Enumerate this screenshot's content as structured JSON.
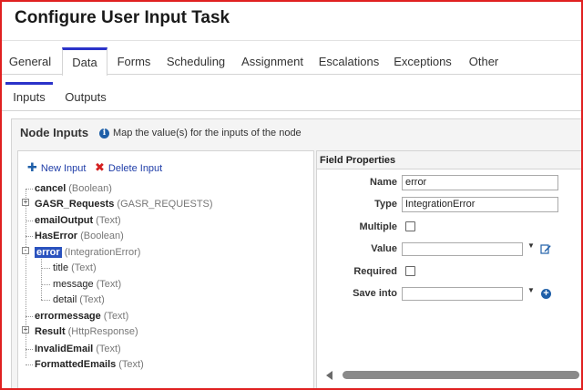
{
  "title": "Configure User Input Task",
  "tabs": [
    {
      "label": "General"
    },
    {
      "label": "Data"
    },
    {
      "label": "Forms"
    },
    {
      "label": "Scheduling"
    },
    {
      "label": "Assignment"
    },
    {
      "label": "Escalations"
    },
    {
      "label": "Exceptions"
    },
    {
      "label": "Other"
    }
  ],
  "active_tab": "Data",
  "subtabs": [
    {
      "label": "Inputs"
    },
    {
      "label": "Outputs"
    }
  ],
  "active_subtab": "Inputs",
  "panel": {
    "title": "Node Inputs",
    "info": "Map the value(s) for the inputs of the node"
  },
  "toolbar": {
    "new_label": "New Input",
    "delete_label": "Delete Input"
  },
  "tree": [
    {
      "name": "cancel",
      "type": "(Boolean)"
    },
    {
      "name": "GASR_Requests",
      "type": "(GASR_REQUESTS)",
      "expander": "+"
    },
    {
      "name": "emailOutput",
      "type": "(Text)"
    },
    {
      "name": "HasError",
      "type": "(Boolean)"
    },
    {
      "name": "error",
      "type": "(IntegrationError)",
      "expander": "-",
      "selected": true
    },
    {
      "name": "title",
      "type": "(Text)",
      "child": true
    },
    {
      "name": "message",
      "type": "(Text)",
      "child": true
    },
    {
      "name": "detail",
      "type": "(Text)",
      "child": true
    },
    {
      "name": "errormessage",
      "type": "(Text)"
    },
    {
      "name": "Result",
      "type": "(HttpResponse)",
      "expander": "+"
    },
    {
      "name": "InvalidEmail",
      "type": "(Text)"
    },
    {
      "name": "FormattedEmails",
      "type": "(Text)"
    }
  ],
  "field_properties": {
    "header": "Field Properties",
    "name_label": "Name",
    "name_value": "error",
    "type_label": "Type",
    "type_value": "IntegrationError",
    "multiple_label": "Multiple",
    "value_label": "Value",
    "required_label": "Required",
    "save_into_label": "Save into"
  },
  "icons": {
    "info": "info-icon",
    "new": "plus-icon",
    "delete": "x-icon",
    "edit": "edit-icon",
    "add": "add-circle-icon"
  },
  "colors": {
    "accent": "#2b33c9",
    "frame": "#e02020",
    "selection": "#2a52be"
  }
}
